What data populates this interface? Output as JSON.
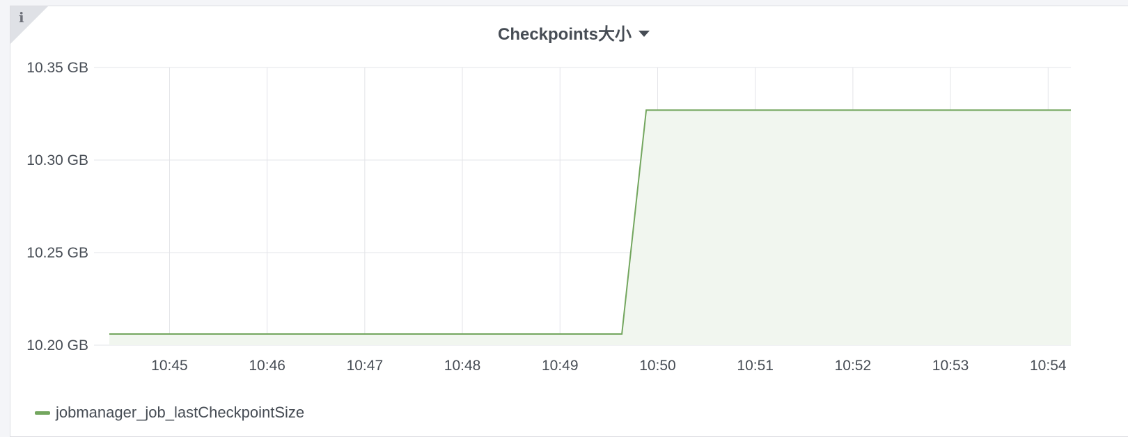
{
  "panel": {
    "title": "Checkpoints大小",
    "info_icon": "i"
  },
  "colors": {
    "series": "#73a65e",
    "fill": "#f1f6ef",
    "grid": "#e3e4e8"
  },
  "chart_data": {
    "type": "area",
    "title": "Checkpoints大小",
    "xlabel": "",
    "ylabel": "",
    "grid": true,
    "legend_position": "bottom-left",
    "x_ticks": [
      "10:45",
      "10:46",
      "10:47",
      "10:48",
      "10:49",
      "10:50",
      "10:51",
      "10:52",
      "10:53",
      "10:54"
    ],
    "y_ticks": [
      "10.20 GB",
      "10.25 GB",
      "10.30 GB",
      "10.35 GB"
    ],
    "y_tick_values": [
      10.2,
      10.25,
      10.3,
      10.35
    ],
    "ylim": [
      10.2,
      10.35
    ],
    "xlim": [
      "10:44:23",
      "10:54:14"
    ],
    "series": [
      {
        "name": "jobmanager_job_lastCheckpointSize",
        "points": [
          {
            "x": "10:44:23",
            "y": 10.206
          },
          {
            "x": "10:49:38",
            "y": 10.206
          },
          {
            "x": "10:49:53",
            "y": 10.327
          },
          {
            "x": "10:54:14",
            "y": 10.327
          }
        ]
      }
    ]
  }
}
